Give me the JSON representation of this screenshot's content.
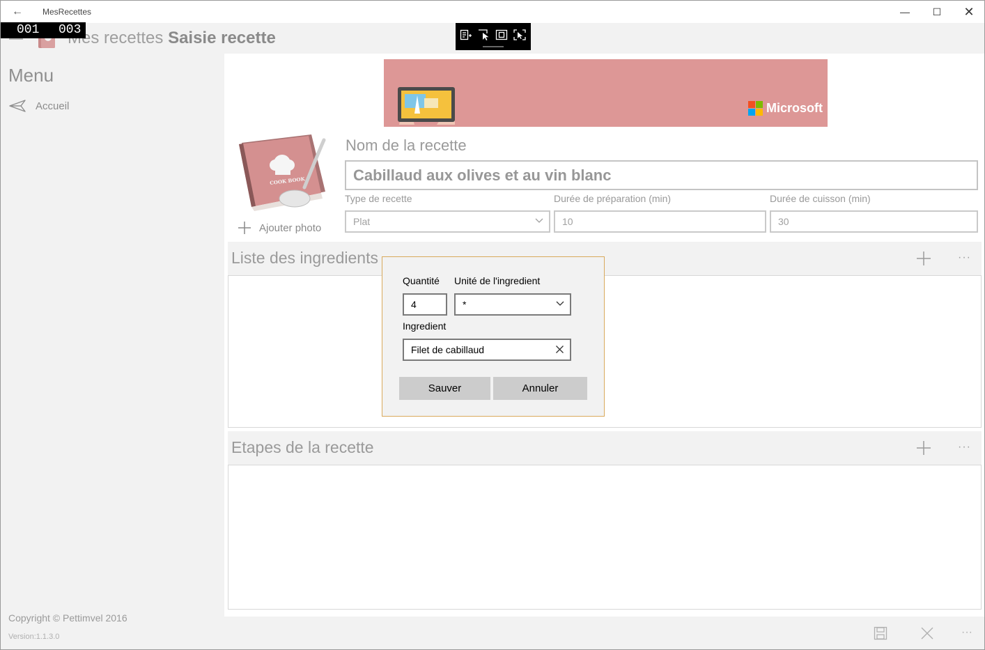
{
  "titlebar": {
    "back_label": "←",
    "title": "MesRecettes",
    "minimize_label": "—",
    "maximize_label": "☐",
    "close_label": "✕"
  },
  "frame_counter": {
    "left": "001",
    "right": "003"
  },
  "debug_toolbar": {
    "icons": [
      "live-visual-tree-icon",
      "select-element-icon",
      "display-layout-adorners-icon",
      "track-focus-icon"
    ]
  },
  "header": {
    "title_light": "Mes recettes",
    "title_bold": "Saisie recette"
  },
  "sidebar": {
    "menu_title": "Menu",
    "items": [
      {
        "label": "Accueil",
        "icon": "send-icon"
      }
    ],
    "copyright": "Copyright © Pettimvel 2016",
    "version": "Version:1.1.3.0"
  },
  "ad": {
    "brand_text": "Microsoft",
    "logo_colors": [
      "#f25022",
      "#7fba00",
      "#00a4ef",
      "#ffb900"
    ]
  },
  "photo": {
    "book_text": "COOK BOOK",
    "add_photo_label": "Ajouter photo"
  },
  "form": {
    "name_label": "Nom de la recette",
    "name_value": "Cabillaud aux olives et au vin blanc",
    "type_label": "Type de recette",
    "type_value": "Plat",
    "prep_label": "Durée de préparation (min)",
    "prep_value": "10",
    "cook_label": "Durée de cuisson (min)",
    "cook_value": "30"
  },
  "ingredients_panel": {
    "title": "Liste des ingredients",
    "more_label": "···"
  },
  "steps_panel": {
    "title": "Etapes de la recette",
    "more_label": "···"
  },
  "command_bar": {
    "more_label": "···"
  },
  "dialog": {
    "quantity_label": "Quantité",
    "quantity_value": "4",
    "unit_label": "Unité de l'ingredient",
    "unit_value": "*",
    "ingredient_label": "Ingredient",
    "ingredient_value": "Filet de cabillaud",
    "save_label": "Sauver",
    "cancel_label": "Annuler"
  },
  "colors": {
    "accent_border": "#d9a95b",
    "ad_background": "#dd9796",
    "chrome_gray": "#f2f2f2"
  }
}
